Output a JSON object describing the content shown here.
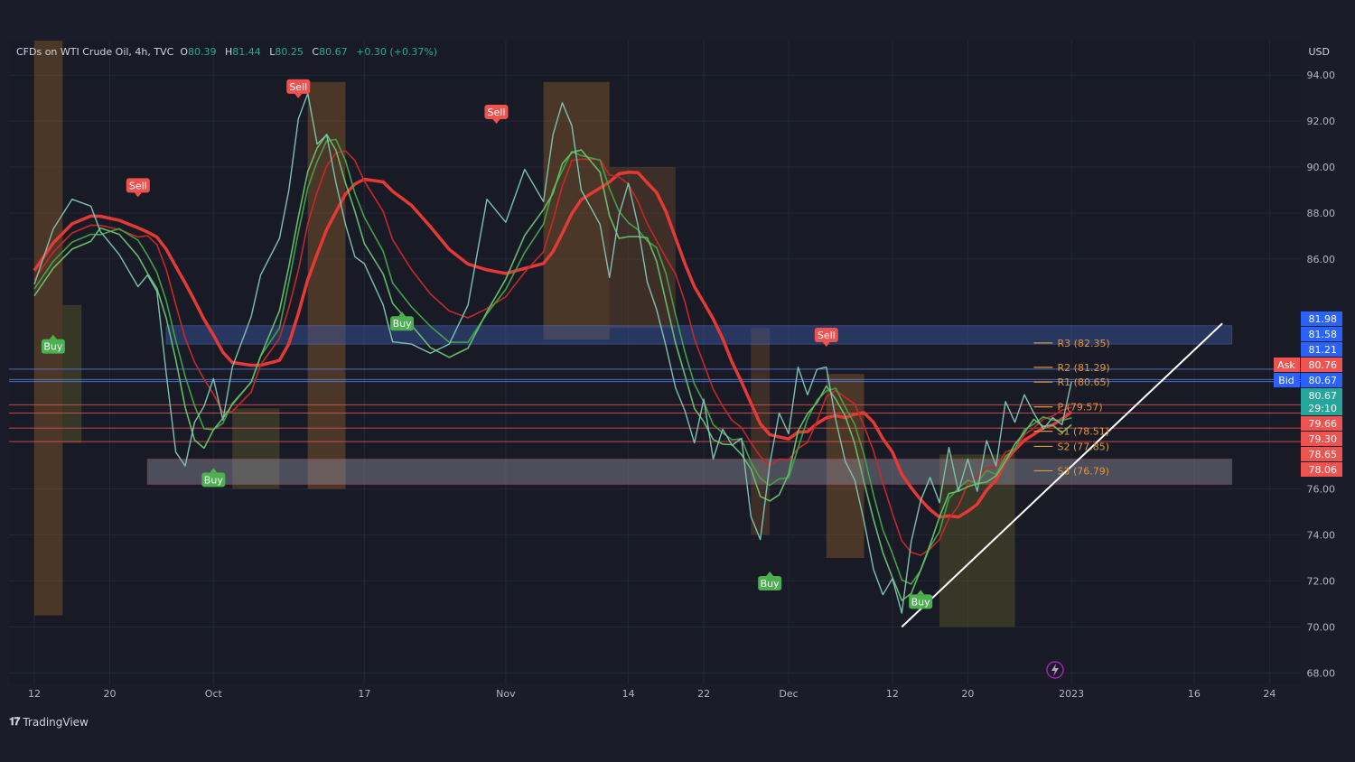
{
  "header": {
    "symbol": "CFDs on WTI Crude Oil, 4h, TVC",
    "o_label": "O",
    "o_value": "80.39",
    "h_label": "H",
    "h_value": "81.44",
    "l_label": "L",
    "l_value": "80.25",
    "c_label": "C",
    "c_value": "80.67",
    "change": "+0.30 (+0.37%)"
  },
  "currency": "USD",
  "brand": "TradingView",
  "colors": {
    "background": "#1a1d29",
    "up": "#26a69a",
    "down": "#ef5350",
    "pivot": "#e0963a",
    "zone": "#6d8bdc",
    "sell": "#ef5350",
    "buy": "#4caf50"
  },
  "chart_data": {
    "type": "line",
    "title": "CFDs on WTI Crude Oil, 4h, TVC",
    "xlabel": "",
    "ylabel": "",
    "ylim": [
      67.5,
      95.5
    ],
    "y_ticks": [
      "94.00",
      "92.00",
      "90.00",
      "88.00",
      "86.00",
      "76.00",
      "74.00",
      "72.00",
      "70.00",
      "68.00"
    ],
    "x_ticks": [
      {
        "label": "12",
        "x": 0
      },
      {
        "label": "20",
        "x": 8
      },
      {
        "label": "Oct",
        "x": 19
      },
      {
        "label": "17",
        "x": 35
      },
      {
        "label": "Nov",
        "x": 50
      },
      {
        "label": "14",
        "x": 63
      },
      {
        "label": "22",
        "x": 71
      },
      {
        "label": "Dec",
        "x": 80
      },
      {
        "label": "12",
        "x": 91
      },
      {
        "label": "20",
        "x": 99
      },
      {
        "label": "2023",
        "x": 110
      },
      {
        "label": "16",
        "x": 123
      },
      {
        "label": "24",
        "x": 131
      }
    ],
    "series": [
      {
        "values": [
          [
            0,
            84.9
          ],
          [
            2,
            87.3
          ],
          [
            4,
            88.6
          ],
          [
            6,
            88.3
          ],
          [
            7,
            87.2
          ],
          [
            9,
            86.2
          ],
          [
            11,
            84.8
          ],
          [
            12,
            85.3
          ],
          [
            13,
            84.6
          ],
          [
            14,
            81.0
          ],
          [
            15,
            77.6
          ],
          [
            16,
            77.0
          ],
          [
            17,
            78.9
          ],
          [
            18,
            79.6
          ],
          [
            19,
            80.8
          ],
          [
            20,
            79.0
          ],
          [
            21,
            81.3
          ],
          [
            23,
            83.5
          ],
          [
            24,
            85.3
          ],
          [
            26,
            86.9
          ],
          [
            27,
            89.0
          ],
          [
            28,
            92.1
          ],
          [
            29,
            93.2
          ],
          [
            30,
            91.0
          ],
          [
            31,
            91.4
          ],
          [
            32,
            89.3
          ],
          [
            33,
            87.5
          ],
          [
            34,
            86.1
          ],
          [
            35,
            85.8
          ],
          [
            37,
            84.0
          ],
          [
            38,
            82.4
          ],
          [
            40,
            82.3
          ],
          [
            42,
            81.9
          ],
          [
            44,
            82.3
          ],
          [
            46,
            84.0
          ],
          [
            48,
            88.6
          ],
          [
            50,
            87.6
          ],
          [
            52,
            89.9
          ],
          [
            54,
            88.5
          ],
          [
            55,
            91.4
          ],
          [
            56,
            92.8
          ],
          [
            57,
            91.8
          ],
          [
            58,
            89.0
          ],
          [
            60,
            87.5
          ],
          [
            61,
            85.2
          ],
          [
            62,
            87.9
          ],
          [
            63,
            89.3
          ],
          [
            64,
            87.5
          ],
          [
            65,
            85.0
          ],
          [
            66,
            83.8
          ],
          [
            67,
            82.2
          ],
          [
            68,
            80.4
          ],
          [
            69,
            79.4
          ],
          [
            70,
            78.0
          ],
          [
            71,
            79.9
          ],
          [
            72,
            77.3
          ],
          [
            73,
            78.6
          ],
          [
            74,
            77.9
          ],
          [
            75,
            78.2
          ],
          [
            76,
            74.8
          ],
          [
            77,
            73.8
          ],
          [
            78,
            77.1
          ],
          [
            79,
            79.3
          ],
          [
            80,
            78.4
          ],
          [
            81,
            81.3
          ],
          [
            82,
            80.1
          ],
          [
            83,
            81.2
          ],
          [
            84,
            81.3
          ],
          [
            85,
            79.0
          ],
          [
            86,
            77.2
          ],
          [
            87,
            76.4
          ],
          [
            88,
            74.6
          ],
          [
            89,
            72.5
          ],
          [
            90,
            71.4
          ],
          [
            91,
            72.1
          ],
          [
            92,
            70.6
          ],
          [
            93,
            73.7
          ],
          [
            94,
            75.5
          ],
          [
            95,
            76.5
          ],
          [
            96,
            75.4
          ],
          [
            97,
            77.8
          ],
          [
            98,
            75.9
          ],
          [
            99,
            77.3
          ],
          [
            100,
            75.9
          ],
          [
            101,
            78.1
          ],
          [
            102,
            77.0
          ],
          [
            103,
            79.8
          ],
          [
            104,
            78.9
          ],
          [
            105,
            80.1
          ],
          [
            106,
            79.3
          ],
          [
            107,
            78.6
          ],
          [
            108,
            79.1
          ],
          [
            109,
            78.8
          ],
          [
            110,
            80.67
          ]
        ]
      }
    ],
    "price_labels": [
      "81.98",
      "81.58",
      "81.21",
      "80.76",
      "80.67",
      "80.67",
      "29:10",
      "79.66",
      "79.30",
      "78.65",
      "78.06"
    ],
    "ask_label": "Ask",
    "bid_label": "Bid",
    "pivots": [
      {
        "label": "R3 (82.35)",
        "value": 82.35
      },
      {
        "label": "R2 (81.29)",
        "value": 81.29
      },
      {
        "label": "R1 (80.65)",
        "value": 80.65
      },
      {
        "label": "P (79.57)",
        "value": 79.57
      },
      {
        "label": "S1 (78.51)",
        "value": 78.51
      },
      {
        "label": "S2 (77.85)",
        "value": 77.85
      },
      {
        "label": "S3 (76.79)",
        "value": 76.79
      }
    ],
    "zones": [
      {
        "name": "resistance",
        "from": 82.3,
        "to": 83.1,
        "x0": 14,
        "x1": 127
      },
      {
        "name": "support",
        "from": 76.2,
        "to": 77.3,
        "x0": 12,
        "x1": 127
      }
    ],
    "signals": [
      {
        "label": "Buy",
        "x": 2,
        "y": 82.2,
        "dir": "up"
      },
      {
        "label": "Sell",
        "x": 11,
        "y": 89.2,
        "dir": "down"
      },
      {
        "label": "Buy",
        "x": 19,
        "y": 76.4,
        "dir": "up"
      },
      {
        "label": "Sell",
        "x": 28,
        "y": 93.5,
        "dir": "down"
      },
      {
        "label": "Buy",
        "x": 39,
        "y": 83.2,
        "dir": "up"
      },
      {
        "label": "Sell",
        "x": 49,
        "y": 92.4,
        "dir": "down"
      },
      {
        "label": "Buy",
        "x": 78,
        "y": 71.9,
        "dir": "up"
      },
      {
        "label": "Sell",
        "x": 84,
        "y": 82.7,
        "dir": "down"
      },
      {
        "label": "Buy",
        "x": 94,
        "y": 71.1,
        "dir": "up"
      }
    ],
    "trendline": {
      "x0": 92,
      "y0": 70.0,
      "x1": 126,
      "y1": 83.2
    },
    "grid": true
  }
}
